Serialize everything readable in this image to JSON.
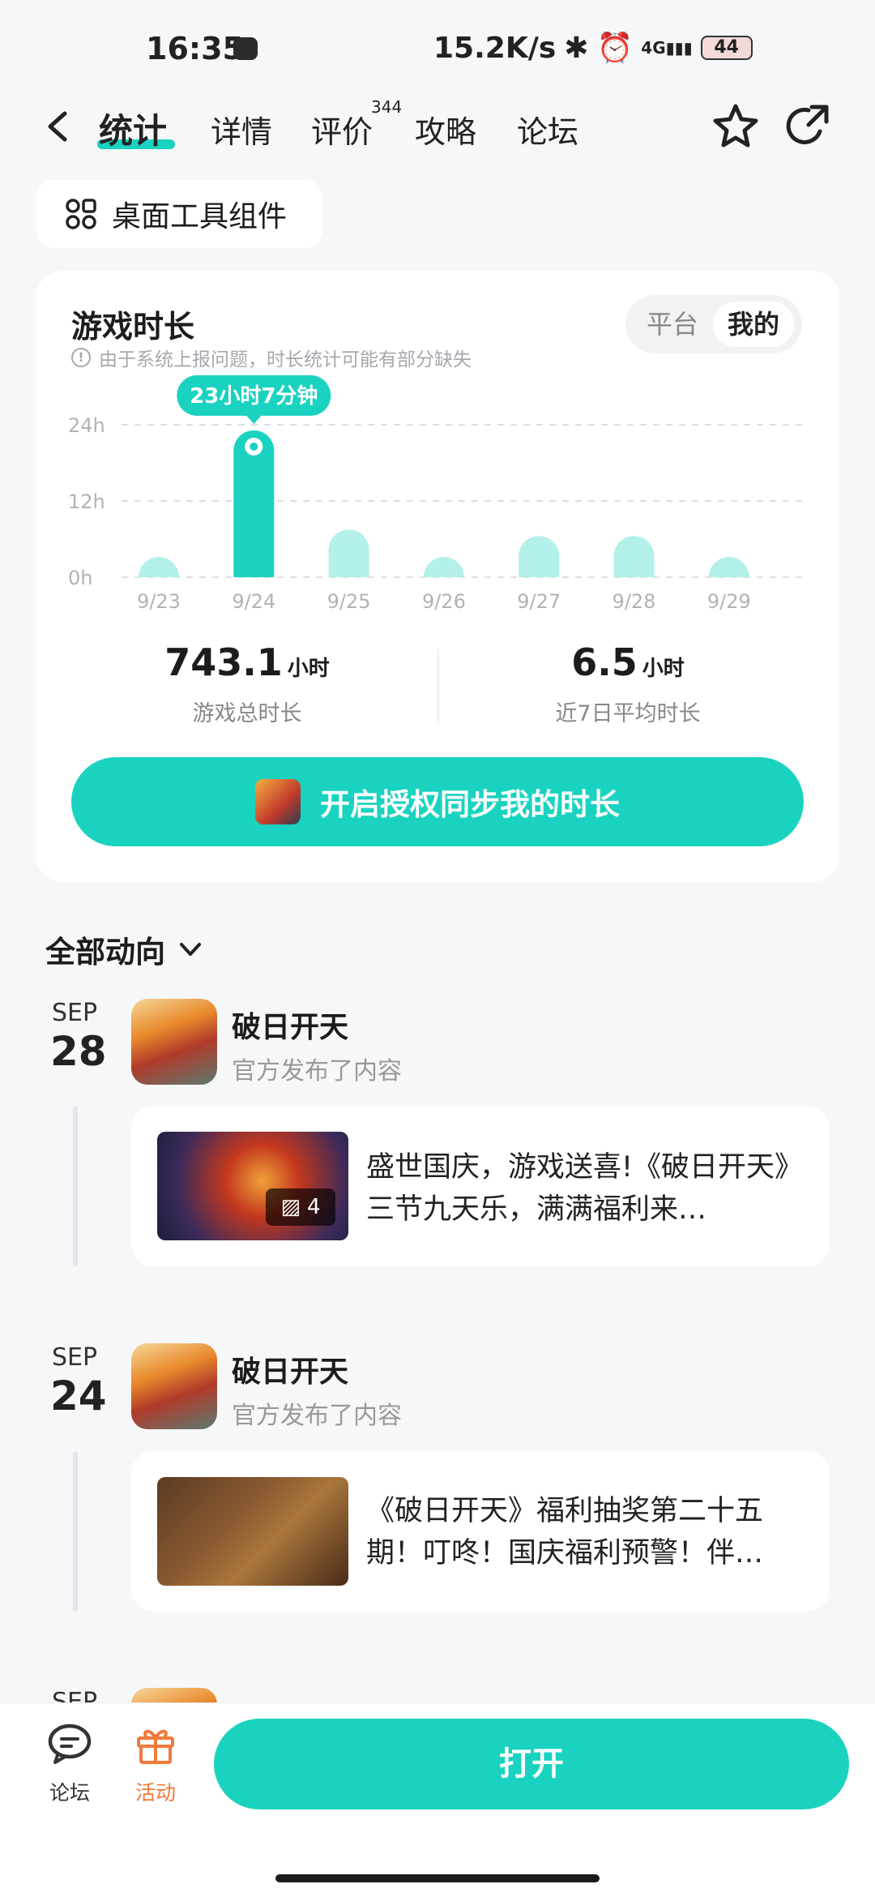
{
  "status_bar": {
    "time": "16:35",
    "speed": "15.2K/s",
    "network": "4G",
    "battery": "44"
  },
  "nav": {
    "tabs": [
      "统计",
      "详情",
      "评价",
      "攻略",
      "论坛"
    ],
    "review_count": "344"
  },
  "widget_chip": {
    "label": "桌面工具组件"
  },
  "playtime": {
    "title": "游戏时长",
    "note": "由于系统上报问题，时长统计可能有部分缺失",
    "segments": [
      "平台",
      "我的"
    ],
    "selected_segment": "我的",
    "tooltip": "23小时7分钟",
    "total_value": "743.1",
    "total_unit": "小时",
    "total_label": "游戏总时长",
    "avg_value": "6.5",
    "avg_unit": "小时",
    "avg_label": "近7日平均时长",
    "sync_button": "开启授权同步我的时长"
  },
  "chart_data": {
    "type": "bar",
    "categories": [
      "9/23",
      "9/24",
      "9/25",
      "9/26",
      "9/27",
      "9/28",
      "9/29"
    ],
    "values": [
      1.0,
      23.12,
      7.5,
      1.0,
      6.5,
      6.5,
      1.0
    ],
    "y_ticks": [
      "24h",
      "12h",
      "0h"
    ],
    "ylim": [
      0,
      24
    ],
    "highlight_index": 1,
    "grid": true,
    "colors": {
      "highlight": "#19d3c0",
      "normal": "#b3f0ea",
      "grid": "#dcdfe3"
    }
  },
  "feed": {
    "filter_label": "全部动向",
    "items": [
      {
        "month": "SEP",
        "day": "28",
        "poster": "破日开天",
        "action": "官方发布了内容",
        "title": "盛世国庆，游戏送喜!《破日开天》三节九天乐，满满福利来…",
        "image_count": "4"
      },
      {
        "month": "SEP",
        "day": "24",
        "poster": "破日开天",
        "action": "官方发布了内容",
        "title": "《破日开天》福利抽奖第二十五期！叮咚！国庆福利预警！伴…"
      }
    ],
    "next_month": "SEP"
  },
  "bottom_bar": {
    "forum": "论坛",
    "event": "活动",
    "open": "打开"
  },
  "colors": {
    "accent": "#19d3c0",
    "event": "#f07a3a"
  }
}
